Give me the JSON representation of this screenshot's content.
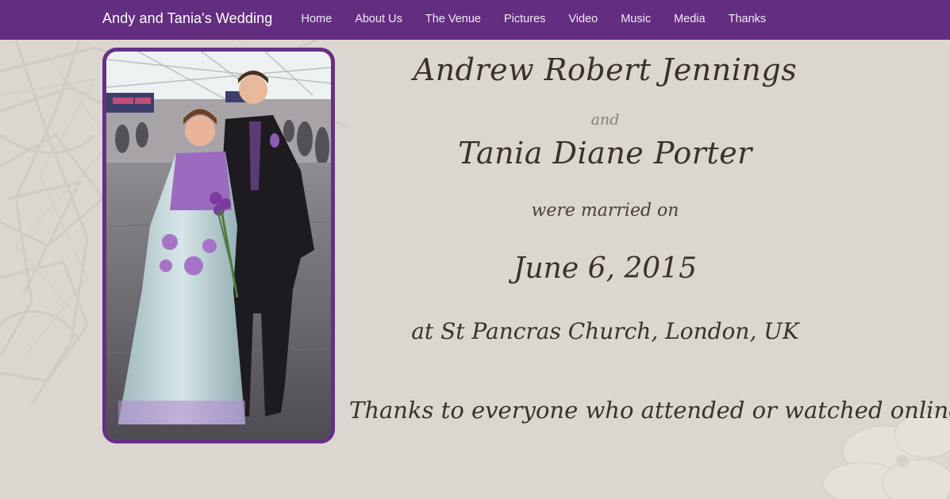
{
  "header": {
    "brand": "Andy and Tania's Wedding",
    "nav": [
      {
        "label": "Home"
      },
      {
        "label": "About Us"
      },
      {
        "label": "The Venue"
      },
      {
        "label": "Pictures"
      },
      {
        "label": "Video"
      },
      {
        "label": "Music"
      },
      {
        "label": "Media"
      },
      {
        "label": "Thanks"
      }
    ]
  },
  "colors": {
    "nav_bg": "#632e7f",
    "page_bg": "#dcd6d0",
    "frame_border": "#662f86",
    "text": "#3b302a"
  },
  "hero": {
    "groom": "Andrew Robert Jennings",
    "conjunction": "and",
    "bride": "Tania Diane Porter",
    "married_text": "were married on",
    "date": "June 6, 2015",
    "venue": "at St Pancras Church, London, UK",
    "thanks": "Thanks to everyone who attended or watched online!"
  }
}
